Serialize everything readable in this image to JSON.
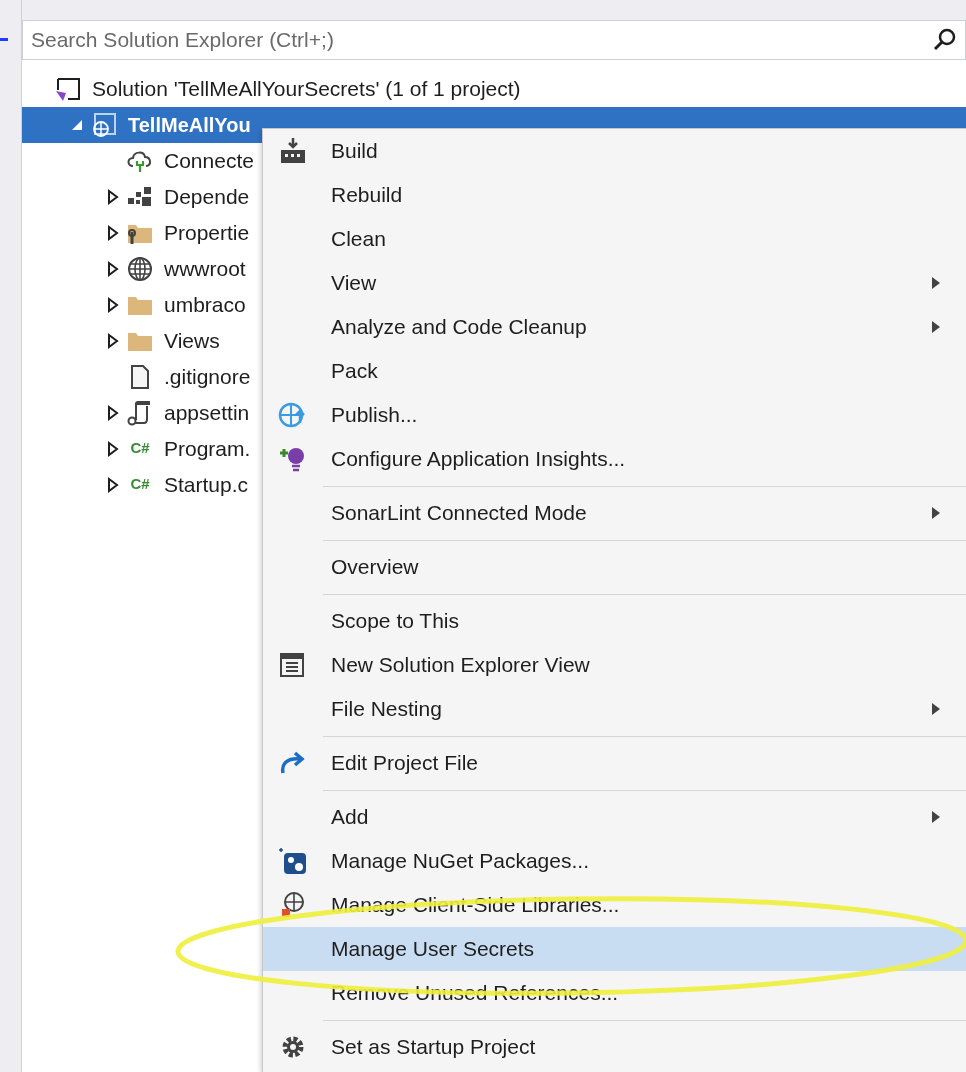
{
  "search": {
    "placeholder": "Search Solution Explorer (Ctrl+;)"
  },
  "tree": [
    {
      "label": "Solution 'TellMeAllYourSecrets' (1 of 1 project)",
      "selected": false,
      "children": [
        {
          "label": "TellMeAllYou",
          "expanded": true,
          "selected": true,
          "children": [
            {
              "label": "Connecte",
              "selected": false
            },
            {
              "label": "Depende",
              "expanded": false,
              "selected": false
            },
            {
              "label": "Propertie",
              "expanded": false,
              "selected": false
            },
            {
              "label": "wwwroot",
              "expanded": false,
              "selected": false
            },
            {
              "label": "umbraco",
              "expanded": false,
              "selected": false
            },
            {
              "label": "Views",
              "expanded": false,
              "selected": false
            },
            {
              "label": ".gitignore",
              "selected": false
            },
            {
              "label": "appsettin",
              "expanded": false,
              "selected": false
            },
            {
              "label": "Program.",
              "icon_text": "C#",
              "expanded": false,
              "selected": false
            },
            {
              "label": "Startup.c",
              "icon_text": "C#",
              "expanded": false,
              "selected": false
            }
          ]
        }
      ]
    }
  ],
  "menu": [
    {
      "kind": "item",
      "label": "Build",
      "submenu": false,
      "selected": false
    },
    {
      "kind": "item",
      "label": "Rebuild",
      "submenu": false,
      "selected": false
    },
    {
      "kind": "item",
      "label": "Clean",
      "submenu": false,
      "selected": false
    },
    {
      "kind": "item",
      "label": "View",
      "submenu": true,
      "selected": false
    },
    {
      "kind": "item",
      "label": "Analyze and Code Cleanup",
      "submenu": true,
      "selected": false
    },
    {
      "kind": "item",
      "label": "Pack",
      "submenu": false,
      "selected": false
    },
    {
      "kind": "item",
      "label": "Publish...",
      "submenu": false,
      "selected": false
    },
    {
      "kind": "item",
      "label": "Configure Application Insights...",
      "submenu": false,
      "selected": false
    },
    {
      "kind": "separator"
    },
    {
      "kind": "item",
      "label": "SonarLint Connected Mode",
      "submenu": true,
      "selected": false
    },
    {
      "kind": "separator"
    },
    {
      "kind": "item",
      "label": "Overview",
      "submenu": false,
      "selected": false
    },
    {
      "kind": "separator"
    },
    {
      "kind": "item",
      "label": "Scope to This",
      "submenu": false,
      "selected": false
    },
    {
      "kind": "item",
      "label": "New Solution Explorer View",
      "submenu": false,
      "selected": false
    },
    {
      "kind": "item",
      "label": "File Nesting",
      "submenu": true,
      "selected": false
    },
    {
      "kind": "separator"
    },
    {
      "kind": "item",
      "label": "Edit Project File",
      "submenu": false,
      "selected": false
    },
    {
      "kind": "separator"
    },
    {
      "kind": "item",
      "label": "Add",
      "submenu": true,
      "selected": false
    },
    {
      "kind": "item",
      "label": "Manage NuGet Packages...",
      "submenu": false,
      "selected": false
    },
    {
      "kind": "item",
      "label": "Manage Client-Side Libraries...",
      "submenu": false,
      "selected": false
    },
    {
      "kind": "item",
      "label": "Manage User Secrets",
      "submenu": false,
      "selected": true
    },
    {
      "kind": "item",
      "label": "Remove Unused References...",
      "submenu": false,
      "selected": false
    },
    {
      "kind": "separator"
    },
    {
      "kind": "item",
      "label": "Set as Startup Project",
      "submenu": false,
      "selected": false
    }
  ],
  "annotations": [
    {
      "kind": "ellipse"
    }
  ]
}
